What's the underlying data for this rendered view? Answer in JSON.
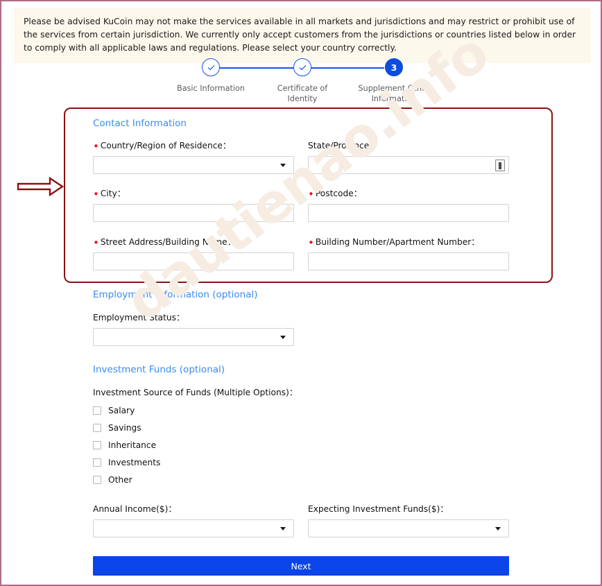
{
  "notice": {
    "text": "Please be advised KuCoin may not make the services available in all markets and jurisdictions and may restrict or prohibit use of the services from certain jurisdiction. We currently only accept customers from the jurisdictions or countries listed below in order to comply with all applicable laws and regulations. Please select your country correctly."
  },
  "watermark": {
    "text": "dautienao.info"
  },
  "stepper": {
    "steps": [
      {
        "label": "Basic Information",
        "marker": "✓",
        "state": "completed"
      },
      {
        "label": "Certificate of Identity",
        "marker": "✓",
        "state": "completed"
      },
      {
        "label": "Supplement Other Information",
        "marker": "3",
        "state": "active"
      }
    ]
  },
  "sections": {
    "contact": {
      "title": "Contact Information"
    },
    "employment": {
      "title": "Employment Information (optional)"
    },
    "investment": {
      "title": "Investment Funds (optional)"
    }
  },
  "fields": {
    "country": {
      "label": "Country/Region of Residence：",
      "required": true,
      "value": "",
      "control": "select"
    },
    "state": {
      "label": "State/Province：",
      "required": false,
      "value": "",
      "control": "text"
    },
    "city": {
      "label": "City：",
      "required": true,
      "value": "",
      "control": "text"
    },
    "postcode": {
      "label": "Postcode：",
      "required": true,
      "value": "",
      "control": "text"
    },
    "street": {
      "label": "Street Address/Building Name：",
      "required": true,
      "value": "",
      "control": "text"
    },
    "building": {
      "label": "Building Number/Apartment Number：",
      "required": true,
      "value": "",
      "control": "text"
    },
    "employment_status": {
      "label": "Employment Status：",
      "required": false,
      "value": "",
      "control": "select"
    },
    "investment_source": {
      "label": "Investment Source of Funds (Multiple Options)：",
      "required": false
    },
    "annual_income": {
      "label": "Annual Income($)：",
      "required": false,
      "value": "",
      "control": "select"
    },
    "expecting_funds": {
      "label": "Expecting Investment Funds($)：",
      "required": false,
      "value": "",
      "control": "select"
    }
  },
  "investment_sources": [
    {
      "label": "Salary",
      "checked": false
    },
    {
      "label": "Savings",
      "checked": false
    },
    {
      "label": "Inheritance",
      "checked": false
    },
    {
      "label": "Investments",
      "checked": false
    },
    {
      "label": "Other",
      "checked": false
    }
  ],
  "actions": {
    "next_label": "Next"
  },
  "colors": {
    "accent_blue": "#0b44e8",
    "section_title_blue": "#3b8aee",
    "step_blue": "#1652f0",
    "required_red": "#e8152b",
    "highlight_red": "#8c1111",
    "frame_pink": "#b06a85",
    "notice_background": "#fdf8ec",
    "watermark": "#f6ece2"
  }
}
